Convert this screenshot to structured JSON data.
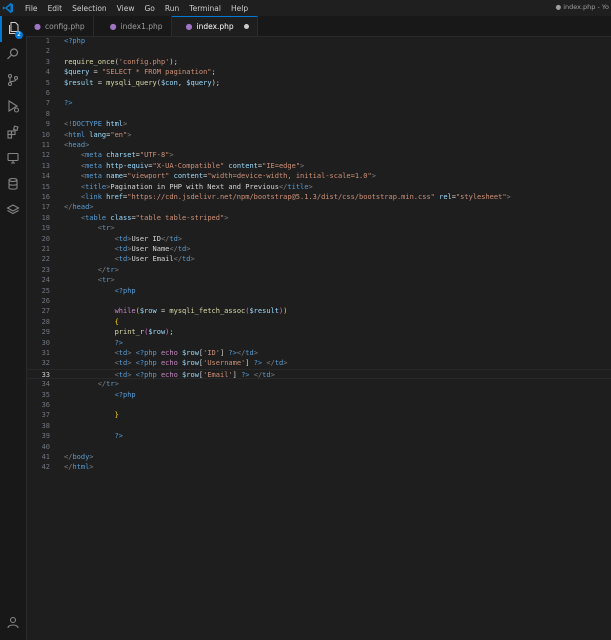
{
  "titlebar": {
    "menu": [
      "File",
      "Edit",
      "Selection",
      "View",
      "Go",
      "Run",
      "Terminal",
      "Help"
    ],
    "window_title": "● index.php - Yo"
  },
  "activity": {
    "explorer_badge": "2"
  },
  "tabs": [
    {
      "label": "config.php",
      "active": false,
      "icon": "php-file-icon"
    },
    {
      "label": "index1.php",
      "active": false,
      "icon": "php-file-icon"
    },
    {
      "label": "index.php",
      "active": true,
      "modified": true,
      "icon": "php-file-icon"
    }
  ],
  "editor": {
    "current_line": 33,
    "lines": [
      {
        "n": "1",
        "tokens": [
          [
            "t-ph",
            "<?php"
          ]
        ]
      },
      {
        "n": "2",
        "tokens": []
      },
      {
        "n": "3",
        "tokens": [
          [
            "t-fn",
            "require_once"
          ],
          [
            "t-txt",
            "("
          ],
          [
            "t-str",
            "'config.php'"
          ],
          [
            "t-txt",
            ");"
          ]
        ]
      },
      {
        "n": "4",
        "tokens": [
          [
            "t-var",
            "$query"
          ],
          [
            "t-txt",
            " = "
          ],
          [
            "t-str",
            "\"SELECT * FROM pagination\""
          ],
          [
            "t-txt",
            ";"
          ]
        ]
      },
      {
        "n": "5",
        "tokens": [
          [
            "t-var",
            "$result"
          ],
          [
            "t-txt",
            " = "
          ],
          [
            "t-fn",
            "mysqli_query"
          ],
          [
            "t-txt",
            "("
          ],
          [
            "t-var",
            "$con"
          ],
          [
            "t-txt",
            ", "
          ],
          [
            "t-var",
            "$query"
          ],
          [
            "t-txt",
            ");"
          ]
        ]
      },
      {
        "n": "6",
        "tokens": []
      },
      {
        "n": "7",
        "tokens": [
          [
            "t-ph",
            "?>"
          ]
        ]
      },
      {
        "n": "8",
        "tokens": []
      },
      {
        "n": "9",
        "tokens": [
          [
            "t-br",
            "<!"
          ],
          [
            "t-tag",
            "DOCTYPE"
          ],
          [
            "t-attr",
            " html"
          ],
          [
            "t-br",
            ">"
          ]
        ]
      },
      {
        "n": "10",
        "tokens": [
          [
            "t-br",
            "<"
          ],
          [
            "t-tag",
            "html"
          ],
          [
            "t-attr",
            " lang"
          ],
          [
            "t-txt",
            "="
          ],
          [
            "t-str",
            "\"en\""
          ],
          [
            "t-br",
            ">"
          ]
        ]
      },
      {
        "n": "11",
        "tokens": [
          [
            "t-br",
            "<"
          ],
          [
            "t-tag",
            "head"
          ],
          [
            "t-br",
            ">"
          ]
        ]
      },
      {
        "n": "12",
        "tokens": [
          [
            "t-txt",
            "    "
          ],
          [
            "t-br",
            "<"
          ],
          [
            "t-tag",
            "meta"
          ],
          [
            "t-attr",
            " charset"
          ],
          [
            "t-txt",
            "="
          ],
          [
            "t-str",
            "\"UTF-8\""
          ],
          [
            "t-br",
            ">"
          ]
        ]
      },
      {
        "n": "13",
        "tokens": [
          [
            "t-txt",
            "    "
          ],
          [
            "t-br",
            "<"
          ],
          [
            "t-tag",
            "meta"
          ],
          [
            "t-attr",
            " http-equiv"
          ],
          [
            "t-txt",
            "="
          ],
          [
            "t-str",
            "\"X-UA-Compatible\""
          ],
          [
            "t-attr",
            " content"
          ],
          [
            "t-txt",
            "="
          ],
          [
            "t-str",
            "\"IE=edge\""
          ],
          [
            "t-br",
            ">"
          ]
        ]
      },
      {
        "n": "14",
        "tokens": [
          [
            "t-txt",
            "    "
          ],
          [
            "t-br",
            "<"
          ],
          [
            "t-tag",
            "meta"
          ],
          [
            "t-attr",
            " name"
          ],
          [
            "t-txt",
            "="
          ],
          [
            "t-str",
            "\"viewport\""
          ],
          [
            "t-attr",
            " content"
          ],
          [
            "t-txt",
            "="
          ],
          [
            "t-str",
            "\"width=device-width, initial-scale=1.0\""
          ],
          [
            "t-br",
            ">"
          ]
        ]
      },
      {
        "n": "15",
        "tokens": [
          [
            "t-txt",
            "    "
          ],
          [
            "t-br",
            "<"
          ],
          [
            "t-tag",
            "title"
          ],
          [
            "t-br",
            ">"
          ],
          [
            "t-txt",
            "Pagination in PHP with Next and Previous"
          ],
          [
            "t-br",
            "</"
          ],
          [
            "t-tag",
            "title"
          ],
          [
            "t-br",
            ">"
          ]
        ]
      },
      {
        "n": "16",
        "tokens": [
          [
            "t-txt",
            "    "
          ],
          [
            "t-br",
            "<"
          ],
          [
            "t-tag",
            "link"
          ],
          [
            "t-attr",
            " href"
          ],
          [
            "t-txt",
            "="
          ],
          [
            "t-str",
            "\"https://cdn.jsdelivr.net/npm/bootstrap@5.1.3/dist/css/bootstrap.min.css\""
          ],
          [
            "t-attr",
            " rel"
          ],
          [
            "t-txt",
            "="
          ],
          [
            "t-str",
            "\"stylesheet\""
          ],
          [
            "t-br",
            ">"
          ]
        ]
      },
      {
        "n": "17",
        "tokens": [
          [
            "t-br",
            "</"
          ],
          [
            "t-tag",
            "head"
          ],
          [
            "t-br",
            ">"
          ]
        ]
      },
      {
        "n": "18",
        "tokens": [
          [
            "t-txt",
            "    "
          ],
          [
            "t-br",
            "<"
          ],
          [
            "t-tag",
            "table"
          ],
          [
            "t-attr",
            " class"
          ],
          [
            "t-txt",
            "="
          ],
          [
            "t-str",
            "\"table table-striped\""
          ],
          [
            "t-br",
            ">"
          ]
        ]
      },
      {
        "n": "19",
        "tokens": [
          [
            "t-txt",
            "        "
          ],
          [
            "t-br",
            "<"
          ],
          [
            "t-tag",
            "tr"
          ],
          [
            "t-br",
            ">"
          ]
        ]
      },
      {
        "n": "20",
        "tokens": [
          [
            "t-txt",
            "            "
          ],
          [
            "t-br",
            "<"
          ],
          [
            "t-tag",
            "td"
          ],
          [
            "t-br",
            ">"
          ],
          [
            "t-txt",
            "User ID"
          ],
          [
            "t-br",
            "</"
          ],
          [
            "t-tag",
            "td"
          ],
          [
            "t-br",
            ">"
          ]
        ]
      },
      {
        "n": "21",
        "tokens": [
          [
            "t-txt",
            "            "
          ],
          [
            "t-br",
            "<"
          ],
          [
            "t-tag",
            "td"
          ],
          [
            "t-br",
            ">"
          ],
          [
            "t-txt",
            "User Name"
          ],
          [
            "t-br",
            "</"
          ],
          [
            "t-tag",
            "td"
          ],
          [
            "t-br",
            ">"
          ]
        ]
      },
      {
        "n": "22",
        "tokens": [
          [
            "t-txt",
            "            "
          ],
          [
            "t-br",
            "<"
          ],
          [
            "t-tag",
            "td"
          ],
          [
            "t-br",
            ">"
          ],
          [
            "t-txt",
            "User Email"
          ],
          [
            "t-br",
            "</"
          ],
          [
            "t-tag",
            "td"
          ],
          [
            "t-br",
            ">"
          ]
        ]
      },
      {
        "n": "23",
        "tokens": [
          [
            "t-txt",
            "        "
          ],
          [
            "t-br",
            "</"
          ],
          [
            "t-tag",
            "tr"
          ],
          [
            "t-br",
            ">"
          ]
        ]
      },
      {
        "n": "24",
        "tokens": [
          [
            "t-txt",
            "        "
          ],
          [
            "t-br",
            "<"
          ],
          [
            "t-tag",
            "tr"
          ],
          [
            "t-br",
            ">"
          ]
        ]
      },
      {
        "n": "25",
        "tokens": [
          [
            "t-txt",
            "            "
          ],
          [
            "t-ph",
            "<?php"
          ]
        ]
      },
      {
        "n": "26",
        "tokens": []
      },
      {
        "n": "27",
        "tokens": [
          [
            "t-txt",
            "            "
          ],
          [
            "t-kw",
            "while"
          ],
          [
            "t-brace",
            "("
          ],
          [
            "t-var",
            "$row"
          ],
          [
            "t-txt",
            " = "
          ],
          [
            "t-fn",
            "mysqli_fetch_assoc"
          ],
          [
            "t-paren",
            "("
          ],
          [
            "t-var",
            "$result"
          ],
          [
            "t-paren",
            ")"
          ],
          [
            "t-brace",
            ")"
          ]
        ]
      },
      {
        "n": "28",
        "tokens": [
          [
            "t-txt",
            "            "
          ],
          [
            "t-brace",
            "{"
          ]
        ]
      },
      {
        "n": "29",
        "tokens": [
          [
            "t-txt",
            "            "
          ],
          [
            "t-fn",
            "print_r"
          ],
          [
            "t-paren",
            "("
          ],
          [
            "t-var",
            "$row"
          ],
          [
            "t-paren",
            ")"
          ],
          [
            "t-txt",
            ";"
          ]
        ]
      },
      {
        "n": "30",
        "tokens": [
          [
            "t-txt",
            "            "
          ],
          [
            "t-ph",
            "?>"
          ]
        ]
      },
      {
        "n": "31",
        "tokens": [
          [
            "t-txt",
            "            "
          ],
          [
            "t-br",
            "<"
          ],
          [
            "t-tag",
            "td"
          ],
          [
            "t-br",
            ">"
          ],
          [
            "t-txt",
            " "
          ],
          [
            "t-ph",
            "<?php"
          ],
          [
            "t-kw",
            " echo "
          ],
          [
            "t-var",
            "$row"
          ],
          [
            "t-txt",
            "["
          ],
          [
            "t-str",
            "'ID'"
          ],
          [
            "t-txt",
            "] "
          ],
          [
            "t-ph",
            "?>"
          ],
          [
            "t-br",
            "</"
          ],
          [
            "t-tag",
            "td"
          ],
          [
            "t-br",
            ">"
          ]
        ]
      },
      {
        "n": "32",
        "tokens": [
          [
            "t-txt",
            "            "
          ],
          [
            "t-br",
            "<"
          ],
          [
            "t-tag",
            "td"
          ],
          [
            "t-br",
            ">"
          ],
          [
            "t-txt",
            " "
          ],
          [
            "t-ph",
            "<?php"
          ],
          [
            "t-kw",
            " echo "
          ],
          [
            "t-var",
            "$row"
          ],
          [
            "t-txt",
            "["
          ],
          [
            "t-str",
            "'Username'"
          ],
          [
            "t-txt",
            "] "
          ],
          [
            "t-ph",
            "?>"
          ],
          [
            "t-txt",
            " "
          ],
          [
            "t-br",
            "</"
          ],
          [
            "t-tag",
            "td"
          ],
          [
            "t-br",
            ">"
          ]
        ]
      },
      {
        "n": "33",
        "tokens": [
          [
            "t-txt",
            "            "
          ],
          [
            "t-br",
            "<"
          ],
          [
            "t-tag",
            "td"
          ],
          [
            "t-br",
            ">"
          ],
          [
            "t-txt",
            " "
          ],
          [
            "t-ph",
            "<?php"
          ],
          [
            "t-kw",
            " echo "
          ],
          [
            "t-var",
            "$row"
          ],
          [
            "t-txt",
            "["
          ],
          [
            "t-str",
            "'Email'"
          ],
          [
            "t-txt",
            "] "
          ],
          [
            "t-ph",
            "?>"
          ],
          [
            "t-txt",
            " "
          ],
          [
            "t-br",
            "</"
          ],
          [
            "t-tag",
            "td"
          ],
          [
            "t-br",
            ">"
          ]
        ]
      },
      {
        "n": "34",
        "tokens": [
          [
            "t-txt",
            "        "
          ],
          [
            "t-br",
            "</"
          ],
          [
            "t-tag",
            "tr"
          ],
          [
            "t-br",
            ">"
          ]
        ]
      },
      {
        "n": "35",
        "tokens": [
          [
            "t-txt",
            "            "
          ],
          [
            "t-ph",
            "<?php"
          ]
        ]
      },
      {
        "n": "36",
        "tokens": []
      },
      {
        "n": "37",
        "tokens": [
          [
            "t-txt",
            "            "
          ],
          [
            "t-brace",
            "}"
          ]
        ]
      },
      {
        "n": "38",
        "tokens": []
      },
      {
        "n": "39",
        "tokens": [
          [
            "t-txt",
            "            "
          ],
          [
            "t-ph",
            "?>"
          ]
        ]
      },
      {
        "n": "40",
        "tokens": []
      },
      {
        "n": "41",
        "tokens": [
          [
            "t-br",
            "</"
          ],
          [
            "t-tag",
            "body"
          ],
          [
            "t-br",
            ">"
          ]
        ]
      },
      {
        "n": "42",
        "tokens": [
          [
            "t-br",
            "</"
          ],
          [
            "t-tag",
            "html"
          ],
          [
            "t-br",
            ">"
          ]
        ]
      }
    ]
  }
}
